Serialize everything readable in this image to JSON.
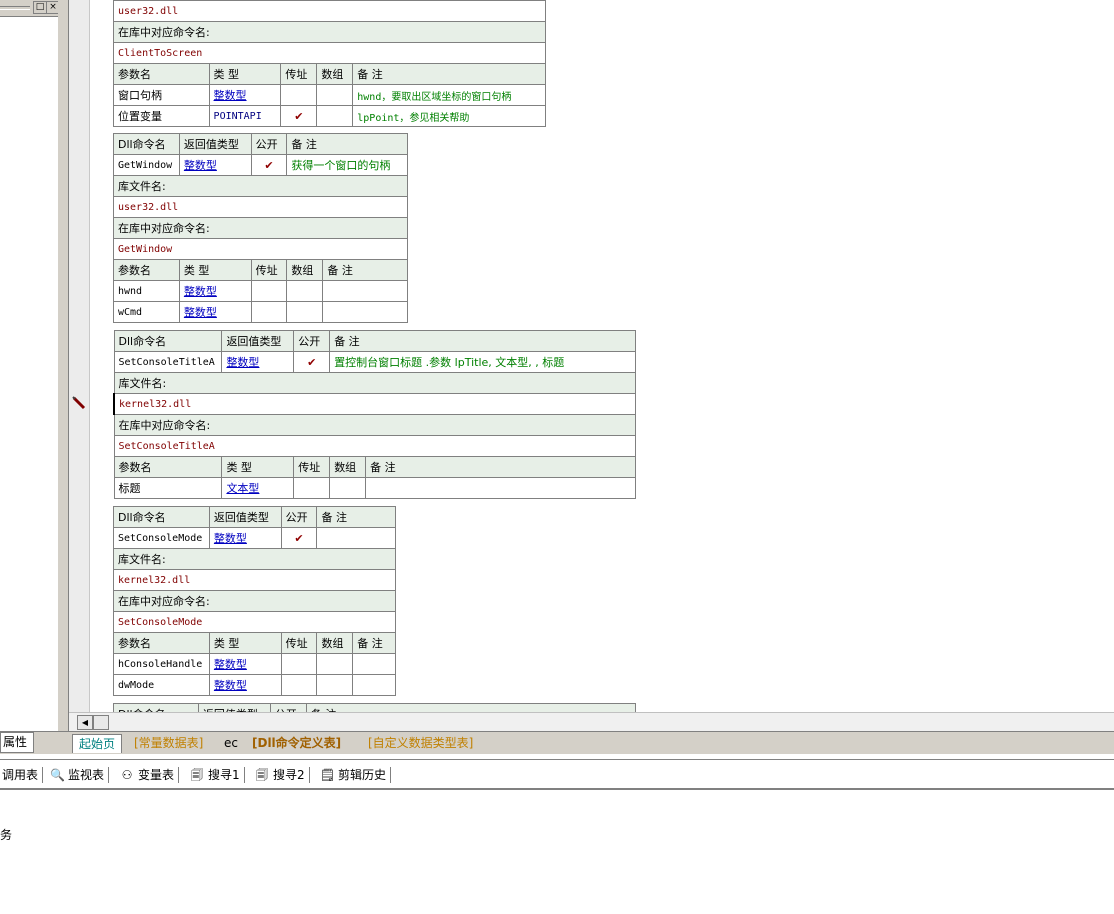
{
  "left_panel": {
    "pin_label": "□",
    "close_label": "×"
  },
  "tables": [
    {
      "rows": [
        {
          "kind": "mono",
          "cells": [
            "user32.dll"
          ]
        },
        {
          "kind": "header",
          "cells": [
            "在库中对应命令名:"
          ]
        },
        {
          "kind": "mono",
          "cells": [
            "ClientToScreen"
          ]
        },
        {
          "kind": "header",
          "cells": [
            "参数名",
            "类 型",
            "传址",
            "数组",
            "备 注"
          ]
        },
        {
          "kind": "param",
          "cells": [
            "窗口句柄",
            "整数型",
            "",
            "",
            "hwnd，要取出区域坐标的窗口句柄"
          ]
        },
        {
          "kind": "param",
          "cells": [
            "位置变量",
            "POINTAPI",
            "✔",
            "",
            "lpPoint，参见相关帮助"
          ]
        }
      ]
    },
    {
      "rows": [
        {
          "kind": "header",
          "cells": [
            "Dll命令名",
            "返回值类型",
            "公开",
            "备 注"
          ]
        },
        {
          "kind": "cmd",
          "cells": [
            "GetWindow",
            "整数型",
            "✔",
            "获得一个窗口的句柄"
          ]
        },
        {
          "kind": "header",
          "cells": [
            "库文件名:"
          ]
        },
        {
          "kind": "mono",
          "cells": [
            "user32.dll"
          ]
        },
        {
          "kind": "header",
          "cells": [
            "在库中对应命令名:"
          ]
        },
        {
          "kind": "mono",
          "cells": [
            "GetWindow"
          ]
        },
        {
          "kind": "header",
          "cells": [
            "参数名",
            "类 型",
            "传址",
            "数组",
            "备 注"
          ]
        },
        {
          "kind": "param",
          "cells": [
            "hwnd",
            "整数型",
            "",
            "",
            ""
          ]
        },
        {
          "kind": "param",
          "cells": [
            "wCmd",
            "整数型",
            "",
            "",
            ""
          ]
        }
      ]
    },
    {
      "rows": [
        {
          "kind": "header",
          "cells": [
            "Dll命令名",
            "返回值类型",
            "公开",
            "备 注"
          ]
        },
        {
          "kind": "cmd",
          "cells": [
            "SetConsoleTitleA",
            "整数型",
            "✔",
            "置控制台窗口标题    .参数 lpTitle, 文本型, , 标题"
          ]
        },
        {
          "kind": "header",
          "cells": [
            "库文件名:"
          ]
        },
        {
          "kind": "mono",
          "cells": [
            "kernel32.dll"
          ]
        },
        {
          "kind": "header",
          "cells": [
            "在库中对应命令名:"
          ]
        },
        {
          "kind": "mono",
          "cells": [
            "SetConsoleTitleA"
          ]
        },
        {
          "kind": "header",
          "cells": [
            "参数名",
            "类 型",
            "传址",
            "数组",
            "备 注"
          ]
        },
        {
          "kind": "param",
          "cells": [
            "标题",
            "文本型",
            "",
            "",
            ""
          ]
        }
      ]
    },
    {
      "rows": [
        {
          "kind": "header",
          "cells": [
            "Dll命令名",
            "返回值类型",
            "公开",
            "备 注"
          ]
        },
        {
          "kind": "cmd",
          "cells": [
            "SetConsoleMode",
            "整数型",
            "✔",
            ""
          ]
        },
        {
          "kind": "header",
          "cells": [
            "库文件名:"
          ]
        },
        {
          "kind": "mono",
          "cells": [
            "kernel32.dll"
          ]
        },
        {
          "kind": "header",
          "cells": [
            "在库中对应命令名:"
          ]
        },
        {
          "kind": "mono",
          "cells": [
            "SetConsoleMode"
          ]
        },
        {
          "kind": "header",
          "cells": [
            "参数名",
            "类 型",
            "传址",
            "数组",
            "备 注"
          ]
        },
        {
          "kind": "param",
          "cells": [
            "hConsoleHandle",
            "整数型",
            "",
            "",
            ""
          ]
        },
        {
          "kind": "param",
          "cells": [
            "dwMode",
            "整数型",
            "",
            "",
            ""
          ]
        }
      ]
    },
    {
      "rows": [
        {
          "kind": "header",
          "cells": [
            "Dll命令名",
            "返回值类型",
            "公开",
            "备 注"
          ]
        }
      ]
    }
  ],
  "left_tab": "属性",
  "editor_tabs": [
    "起始页",
    "[常量数据表]",
    "ec",
    "[Dll命令定义表]",
    "[自定义数据类型表]"
  ],
  "bottom_tools": [
    "调用表",
    "监视表",
    "变量表",
    "搜寻1",
    "搜寻2",
    "剪辑历史"
  ],
  "status": "务"
}
